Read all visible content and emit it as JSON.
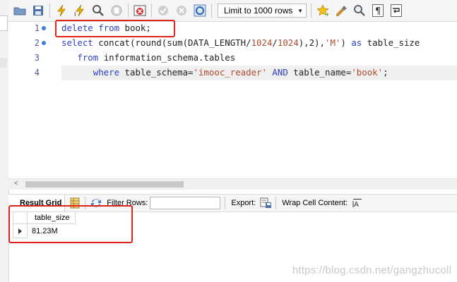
{
  "toolbar": {
    "limit_label": "Limit to 1000 rows",
    "icons": [
      "open-folder-icon",
      "save-icon",
      "execute-icon",
      "execute-current-icon",
      "explain-icon",
      "stop-icon",
      "toggle-error-icon",
      "commit-icon",
      "rollback-icon",
      "autocommit-icon",
      "favorite-icon",
      "beautify-icon",
      "find-icon",
      "invisibles-icon",
      "wrap-icon"
    ]
  },
  "editor": {
    "line_numbers": [
      "1",
      "2",
      "3",
      "4"
    ],
    "lines": [
      [
        {
          "t": "delete",
          "c": "kw"
        },
        {
          "t": " "
        },
        {
          "t": "from",
          "c": "kw"
        },
        {
          "t": " book;"
        }
      ],
      [
        {
          "t": "select",
          "c": "kw"
        },
        {
          "t": " concat(round(sum(DATA_LENGTH/"
        },
        {
          "t": "1024",
          "c": "str"
        },
        {
          "t": "/"
        },
        {
          "t": "1024",
          "c": "str"
        },
        {
          "t": "),2),"
        },
        {
          "t": "'M'",
          "c": "str"
        },
        {
          "t": ") "
        },
        {
          "t": "as",
          "c": "kw"
        },
        {
          "t": " table_size"
        }
      ],
      [
        {
          "t": "   "
        },
        {
          "t": "from",
          "c": "kw"
        },
        {
          "t": " information_schema.tables"
        }
      ],
      [
        {
          "t": "      "
        },
        {
          "t": "where",
          "c": "kw"
        },
        {
          "t": " table_schema="
        },
        {
          "t": "'imooc_reader'",
          "c": "str"
        },
        {
          "t": " "
        },
        {
          "t": "AND",
          "c": "kw"
        },
        {
          "t": " table_name="
        },
        {
          "t": "'book'",
          "c": "str"
        },
        {
          "t": ";"
        }
      ]
    ]
  },
  "result_toolbar": {
    "tab_label": "Result Grid",
    "filter_label": "Filter Rows:",
    "export_label": "Export:",
    "wrap_label": "Wrap Cell Content:"
  },
  "result_grid": {
    "column_header": "table_size",
    "rows": [
      [
        "81.23M"
      ]
    ]
  },
  "watermark": "https://blog.csdn.net/gangzhucoll",
  "colors": {
    "keyword": "#2c3fbf",
    "string": "#b04a2e",
    "highlight_box": "#e0221a"
  }
}
